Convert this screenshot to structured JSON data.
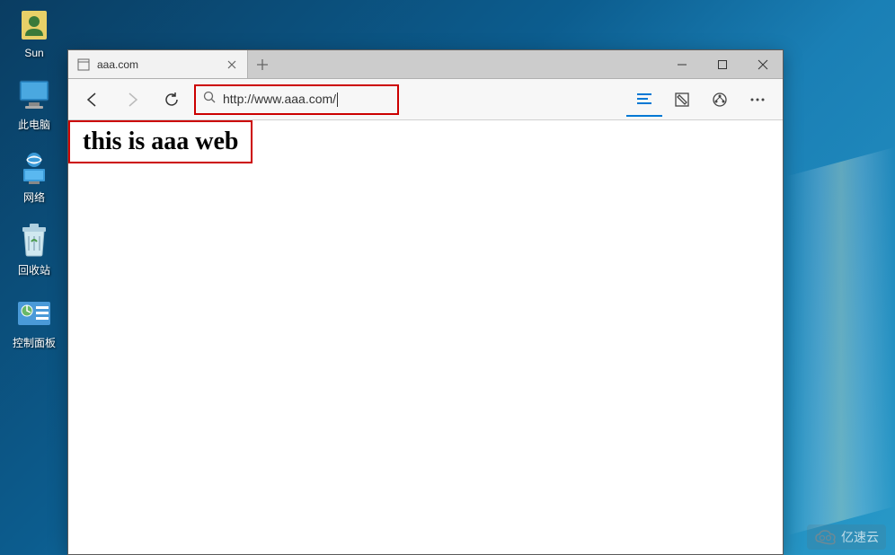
{
  "desktop": {
    "icons": [
      {
        "name": "sun-user",
        "label": "Sun"
      },
      {
        "name": "this-pc",
        "label": "此电脑"
      },
      {
        "name": "network",
        "label": "网络"
      },
      {
        "name": "recycle-bin",
        "label": "回收站"
      },
      {
        "name": "control-panel",
        "label": "控制面板"
      }
    ]
  },
  "browser": {
    "tab": {
      "title": "aaa.com"
    },
    "address": {
      "url": "http://www.aaa.com/"
    },
    "content": {
      "heading": "this is aaa web"
    }
  },
  "watermark": {
    "text": "亿速云"
  }
}
